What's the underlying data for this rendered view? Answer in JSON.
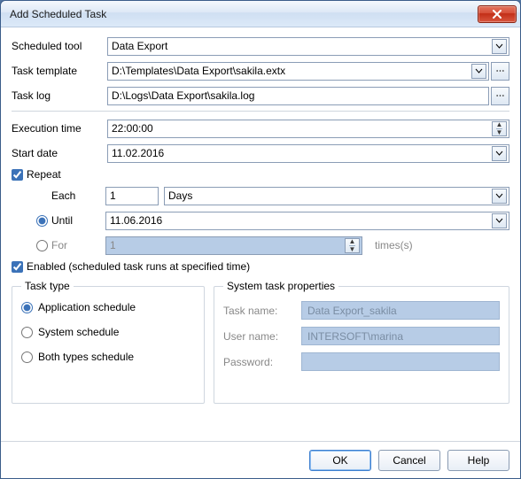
{
  "window": {
    "title": "Add Scheduled Task"
  },
  "labels": {
    "scheduled_tool": "Scheduled tool",
    "task_template": "Task template",
    "task_log": "Task log",
    "execution_time": "Execution time",
    "start_date": "Start date",
    "repeat": "Repeat",
    "each": "Each",
    "until": "Until",
    "for": "For",
    "enabled": "Enabled (scheduled task runs at specified time)",
    "times": "times(s)"
  },
  "fields": {
    "scheduled_tool": "Data Export",
    "task_template": "D:\\Templates\\Data Export\\sakila.extx",
    "task_log": "D:\\Logs\\Data Export\\sakila.log",
    "execution_time": "22:00:00",
    "start_date": "11.02.2016",
    "each_value": "1",
    "each_unit": "Days",
    "until_date": "11.06.2016",
    "for_value": "1"
  },
  "checks": {
    "repeat": true,
    "enabled": true
  },
  "repeat_mode": "until",
  "task_type": {
    "legend": "Task type",
    "options": {
      "app": "Application schedule",
      "system": "System schedule",
      "both": "Both types schedule"
    },
    "selected": "app"
  },
  "sys_props": {
    "legend": "System task properties",
    "labels": {
      "task_name": "Task name:",
      "user_name": "User name:",
      "password": "Password:"
    },
    "values": {
      "task_name": "Data Export_sakila",
      "user_name": "INTERSOFT\\marina",
      "password": ""
    }
  },
  "buttons": {
    "ok": "OK",
    "cancel": "Cancel",
    "help": "Help"
  }
}
